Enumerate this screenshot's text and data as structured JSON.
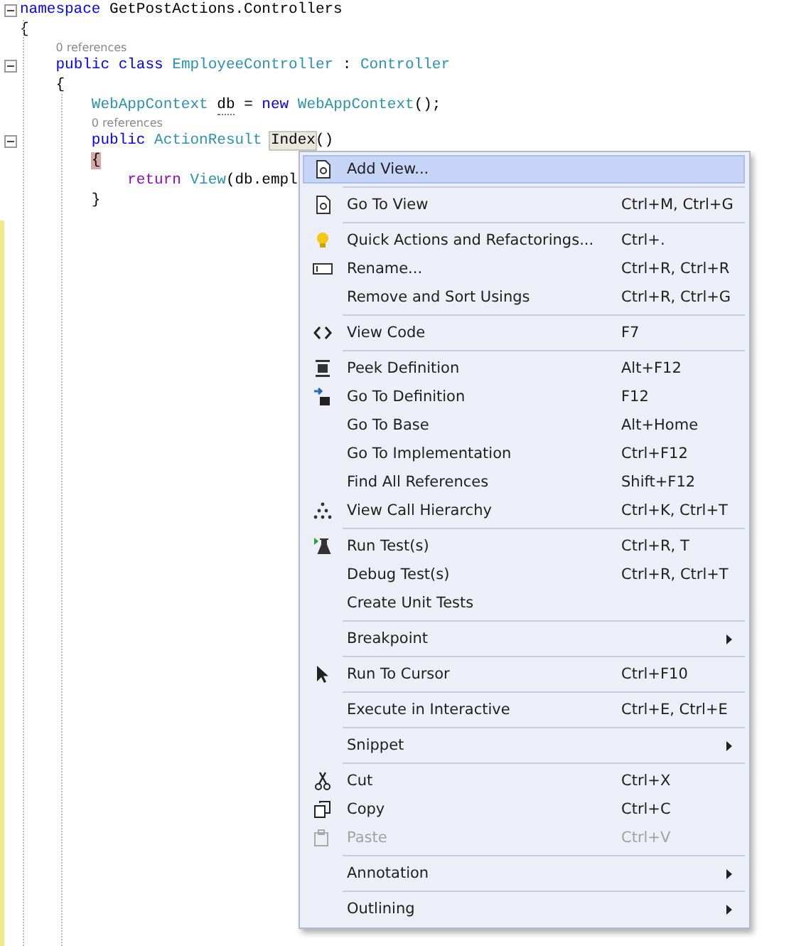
{
  "editor": {
    "lines": [
      {
        "kind": "code",
        "collapsible": true,
        "tokens": [
          {
            "t": "namespace",
            "kind": "keyword"
          },
          {
            "t": " GetPostActions.Controllers",
            "kind": "plain"
          }
        ]
      },
      {
        "kind": "code",
        "collapsible": false,
        "tokens": [
          {
            "t": "{",
            "kind": "plain"
          }
        ]
      },
      {
        "kind": "lens",
        "text": "0 references"
      },
      {
        "kind": "code",
        "collapsible": true,
        "tokens": [
          {
            "t": "    public class ",
            "kind": "keyword"
          },
          {
            "t": "EmployeeController",
            "kind": "type"
          },
          {
            "t": " : ",
            "kind": "plain"
          },
          {
            "t": "Controller",
            "kind": "type"
          }
        ]
      },
      {
        "kind": "code",
        "collapsible": false,
        "tokens": [
          {
            "t": "    {",
            "kind": "plain"
          }
        ]
      },
      {
        "kind": "code",
        "collapsible": false,
        "tokens": [
          {
            "t": "        WebAppContext ",
            "kind": "type"
          },
          {
            "t": "db",
            "kind": "dotted"
          },
          {
            "t": " = ",
            "kind": "plain"
          },
          {
            "t": "new ",
            "kind": "keyword"
          },
          {
            "t": "WebAppContext",
            "kind": "type"
          },
          {
            "t": "();",
            "kind": "plain"
          }
        ]
      },
      {
        "kind": "lens",
        "text": "0 references"
      },
      {
        "kind": "code",
        "collapsible": true,
        "tokens": [
          {
            "t": "        public ",
            "kind": "keyword"
          },
          {
            "t": "ActionResult ",
            "kind": "type"
          },
          {
            "t": "Index",
            "kind": "highlight"
          },
          {
            "t": "()",
            "kind": "plain"
          }
        ]
      },
      {
        "kind": "code",
        "collapsible": false,
        "tokens": [
          {
            "t": "        {",
            "kind": "brace"
          }
        ]
      },
      {
        "kind": "code",
        "collapsible": false,
        "tokens": [
          {
            "t": "            return ",
            "kind": "control"
          },
          {
            "t": "View",
            "kind": "type"
          },
          {
            "t": "(db.empl",
            "kind": "plain"
          }
        ]
      },
      {
        "kind": "code",
        "collapsible": false,
        "tokens": [
          {
            "t": "        }",
            "kind": "plain"
          }
        ]
      }
    ]
  },
  "context_menu": {
    "items": [
      {
        "kind": "item",
        "label": "Add View...",
        "selected": true,
        "disabled": false,
        "submenu": false
      },
      {
        "kind": "separator"
      },
      {
        "kind": "item",
        "label": "Go To View",
        "shortcut": "Ctrl+M, Ctrl+G",
        "selected": false,
        "disabled": false,
        "submenu": false
      },
      {
        "kind": "separator"
      },
      {
        "kind": "item",
        "label": "Quick Actions and Refactorings...",
        "shortcut": "Ctrl+.",
        "selected": false,
        "disabled": false,
        "submenu": false
      },
      {
        "kind": "item",
        "label": "Rename...",
        "shortcut": "Ctrl+R, Ctrl+R",
        "selected": false,
        "disabled": false,
        "submenu": false
      },
      {
        "kind": "item",
        "label": "Remove and Sort Usings",
        "shortcut": "Ctrl+R, Ctrl+G",
        "selected": false,
        "disabled": false,
        "submenu": false
      },
      {
        "kind": "separator"
      },
      {
        "kind": "item",
        "label": "View Code",
        "shortcut": "F7",
        "selected": false,
        "disabled": false,
        "submenu": false
      },
      {
        "kind": "separator"
      },
      {
        "kind": "item",
        "label": "Peek Definition",
        "shortcut": "Alt+F12",
        "selected": false,
        "disabled": false,
        "submenu": false
      },
      {
        "kind": "item",
        "label": "Go To Definition",
        "shortcut": "F12",
        "selected": false,
        "disabled": false,
        "submenu": false
      },
      {
        "kind": "item",
        "label": "Go To Base",
        "shortcut": "Alt+Home",
        "selected": false,
        "disabled": false,
        "submenu": false
      },
      {
        "kind": "item",
        "label": "Go To Implementation",
        "shortcut": "Ctrl+F12",
        "selected": false,
        "disabled": false,
        "submenu": false
      },
      {
        "kind": "item",
        "label": "Find All References",
        "shortcut": "Shift+F12",
        "selected": false,
        "disabled": false,
        "submenu": false
      },
      {
        "kind": "item",
        "label": "View Call Hierarchy",
        "shortcut": "Ctrl+K, Ctrl+T",
        "selected": false,
        "disabled": false,
        "submenu": false
      },
      {
        "kind": "separator"
      },
      {
        "kind": "item",
        "label": "Run Test(s)",
        "shortcut": "Ctrl+R, T",
        "selected": false,
        "disabled": false,
        "submenu": false
      },
      {
        "kind": "item",
        "label": "Debug Test(s)",
        "shortcut": "Ctrl+R, Ctrl+T",
        "selected": false,
        "disabled": false,
        "submenu": false
      },
      {
        "kind": "item",
        "label": "Create Unit Tests",
        "selected": false,
        "disabled": false,
        "submenu": false
      },
      {
        "kind": "separator"
      },
      {
        "kind": "item",
        "label": "Breakpoint",
        "selected": false,
        "disabled": false,
        "submenu": true
      },
      {
        "kind": "separator"
      },
      {
        "kind": "item",
        "label": "Run To Cursor",
        "shortcut": "Ctrl+F10",
        "selected": false,
        "disabled": false,
        "submenu": false
      },
      {
        "kind": "separator"
      },
      {
        "kind": "item",
        "label": "Execute in Interactive",
        "shortcut": "Ctrl+E, Ctrl+E",
        "selected": false,
        "disabled": false,
        "submenu": false
      },
      {
        "kind": "separator"
      },
      {
        "kind": "item",
        "label": "Snippet",
        "selected": false,
        "disabled": false,
        "submenu": true
      },
      {
        "kind": "separator"
      },
      {
        "kind": "item",
        "label": "Cut",
        "shortcut": "Ctrl+X",
        "selected": false,
        "disabled": false,
        "submenu": false
      },
      {
        "kind": "item",
        "label": "Copy",
        "shortcut": "Ctrl+C",
        "selected": false,
        "disabled": false,
        "submenu": false
      },
      {
        "kind": "item",
        "label": "Paste",
        "shortcut": "Ctrl+V",
        "selected": false,
        "disabled": true,
        "submenu": false
      },
      {
        "kind": "separator"
      },
      {
        "kind": "item",
        "label": "Annotation",
        "selected": false,
        "disabled": false,
        "submenu": true
      },
      {
        "kind": "separator"
      },
      {
        "kind": "item",
        "label": "Outlining",
        "selected": false,
        "disabled": false,
        "submenu": true
      }
    ]
  }
}
